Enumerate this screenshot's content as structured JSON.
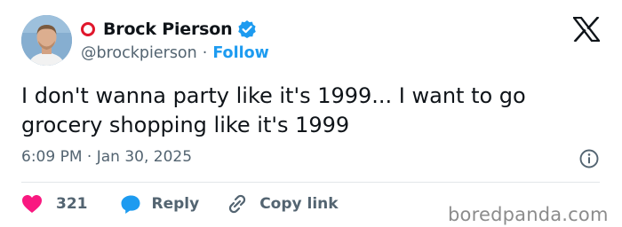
{
  "author": {
    "display_name": "Brock Pierson",
    "handle": "@brockpierson",
    "separator": "·",
    "follow_label": "Follow"
  },
  "tweet": {
    "text": "I don't wanna party like it's 1999... I want to go grocery shopping like it's 1999",
    "timestamp": "6:09 PM · Jan 30, 2025"
  },
  "actions": {
    "like_count": "321",
    "reply_label": "Reply",
    "copy_link_label": "Copy link"
  },
  "watermark": "boredpanda.com",
  "icons": [
    "avatar",
    "red-ring-icon",
    "verified-badge-icon",
    "x-logo-icon",
    "info-icon",
    "heart-icon",
    "reply-icon",
    "link-icon"
  ],
  "colors": {
    "accent": "#1d9bf0",
    "like": "#f91880",
    "ring": "#e0162b",
    "secondary_text": "#536471"
  }
}
